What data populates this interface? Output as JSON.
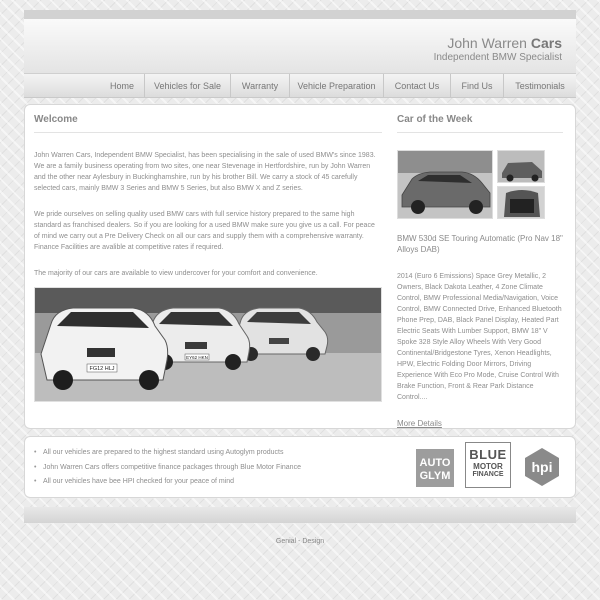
{
  "header": {
    "brand_name_regular": "John Warren ",
    "brand_name_bold": "Cars",
    "tagline": "Independent BMW Specialist"
  },
  "nav": {
    "items": [
      {
        "label": "Home"
      },
      {
        "label": "Vehicles for Sale"
      },
      {
        "label": "Warranty"
      },
      {
        "label": "Vehicle Preparation"
      },
      {
        "label": "Contact Us"
      },
      {
        "label": "Find Us"
      },
      {
        "label": "Testimonials"
      }
    ]
  },
  "welcome": {
    "heading": "Welcome",
    "paragraphs": [
      "John Warren Cars, Independent BMW Specialist, has been specialising in the sale of used BMW's since 1983. We are a family business operating from two sites, one near Stevenage in Hertfordshire, run by John Warren and the other near Aylesbury in Buckinghamshire, run by his brother Bill. We carry a stock of 45 carefully selected cars, mainly BMW 3 Series and BMW 5 Series, but also BMW X and Z series.",
      "We pride ourselves on selling quality used BMW cars with full service history prepared to the same high standard as franchised dealers. So if you are looking for a used BMW make sure you give us a call. For peace of mind we carry out a Pre Delivery Check on all our cars and supply them with a comprehensive warranty. Finance Facilities are avalible at competitive rates if required.",
      "The majority of our cars are available to view undercover for your comfort and convenience."
    ],
    "plates": [
      "FG12 HLJ",
      "EY62 HKN"
    ]
  },
  "car_of_week": {
    "heading": "Car of the Week",
    "title": "BMW 530d SE Touring Automatic (Pro Nav 18\" Alloys DAB)",
    "description": "2014 (Euro 6 Emissions) Space Grey Metallic, 2 Owners, Black Dakota Leather, 4 Zone Climate Control, BMW Professional Media/Navigation, Voice Control, BMW Connected Drive, Enhanced Bluetooth Phone Prep, DAB, Black Panel Display, Heated Part Electric Seats With Lumber Support, BMW 18\" V Spoke 328 Style Alloy Wheels With Very Good Continental/Bridgestone Tyres, Xenon Headlights, HPW, Electric Folding Door Mirrors, Driving Experience With Eco Pro Mode, Cruise Control With Brake Function, Front & Rear Park Distance Control....",
    "more_label": "More Details"
  },
  "features": {
    "bullets": [
      "All our vehicles are prepared to the highest standard using Autoglym products",
      "John Warren Cars offers competitive finance packages through Blue Motor Finance",
      "All our vehicles have bee HPI checked for your peace of mind"
    ],
    "logos": {
      "autoglym_l1": "AUTO",
      "autoglym_l2": "GLYM",
      "blue_l1": "BLUE",
      "blue_l2": "MOTOR",
      "blue_l3": "FINANCE",
      "hpi": "hpi"
    }
  },
  "footer": {
    "credit": "Genial - Design"
  }
}
